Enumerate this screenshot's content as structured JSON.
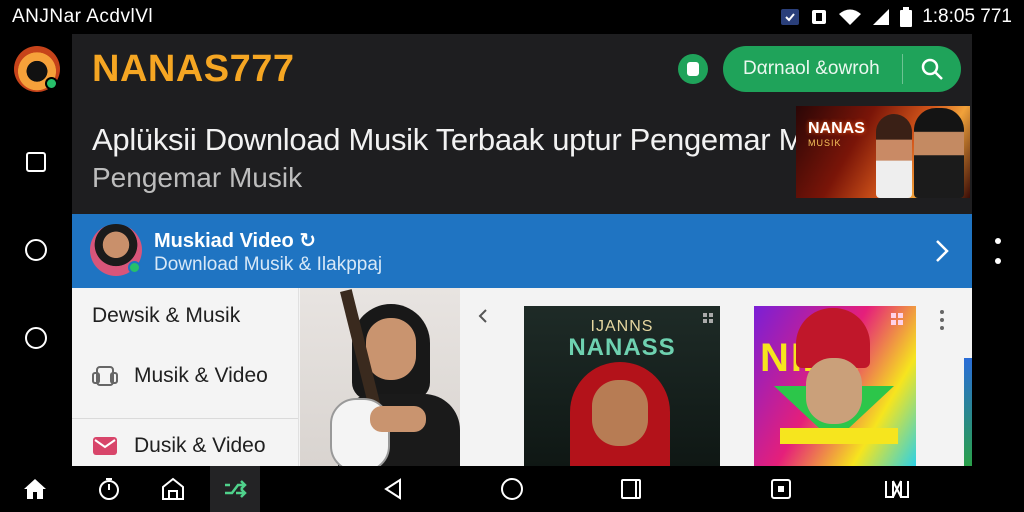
{
  "status_bar": {
    "left_text": "ANJNar AcdvlVl",
    "time": "1:8:05 771",
    "icons": [
      "sync-badge-icon",
      "notification-icon",
      "wifi-icon",
      "signal-icon",
      "battery-icon"
    ]
  },
  "left_rail": {
    "logo_icon": "app-logo",
    "items": [
      "square-icon",
      "circle-icon",
      "circle-icon"
    ]
  },
  "header": {
    "brand": "NANAS777",
    "badge_icon": "store-icon",
    "search_label": "Dαrnaol &owroh",
    "search_icon": "search-icon"
  },
  "hero": {
    "title": "Aplüksii Download Musik Terbaak uptur Pengemar Musik",
    "subtitle": "Pengemar Musik",
    "poster_title": "NANAS",
    "poster_subtitle": "MUSIK"
  },
  "featured": {
    "title": "Muskiad Video ↻",
    "subtitle": "Download Musik & Ilakppaj",
    "chevron_icon": "chevron-right-icon"
  },
  "side_menu": {
    "heading": "Dewsik & Musik",
    "items": [
      {
        "label": "Musik & Video",
        "icon": "music-video-icon"
      },
      {
        "label": "Dusik & Video",
        "icon": "mail-icon"
      }
    ]
  },
  "thumbnails": {
    "second_line1": "IJANNS",
    "second_line2": "NANASS",
    "third_text": "NIZA"
  },
  "nav_bar": {
    "items": [
      "home-icon",
      "timer-icon",
      "library-icon",
      "shuffle-icon",
      "back-icon",
      "home-circle-icon",
      "recents-icon",
      "media-icon",
      "gallery-icon"
    ]
  },
  "colors": {
    "brand": "#f5a623",
    "accent_green": "#1fa35a",
    "blue_row": "#1f74c2"
  }
}
